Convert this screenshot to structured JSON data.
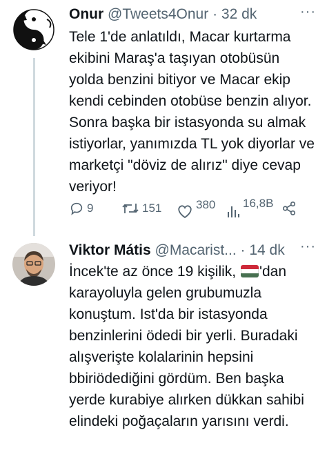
{
  "tweet1": {
    "name": "Onur",
    "handle": "@Tweets4Onur",
    "separator": "·",
    "time": "32 dk",
    "text": "Tele 1'de anlatıldı, Macar kurtarma ekibini Maraş'a taşıyan otobüsün yolda benzini bitiyor ve Macar ekip kendi cebinden otobüse benzin alıyor. Sonra başka bir istasyonda su almak istiyorlar, yanımızda TL yok diyorlar ve marketçi \"döviz de alırız\" diye cevap veriyor!",
    "actions": {
      "replies": "9",
      "retweets": "151",
      "likes": "380",
      "views": "16,8B"
    }
  },
  "tweet2": {
    "name": "Viktor Mátis",
    "handle": "@Macarist...",
    "separator": "·",
    "time": "14 dk",
    "text_before_flag": "İncek'te az önce 19 kişilik, ",
    "text_after_flag": "'dan karayoluyla gelen grubumuzla konuştum. Ist'da bir istasyonda benzinlerini ödedi bir yerli. Buradaki alışverişte kolalarinin hepsini bbiriödediğini gördüm. Ben başka yerde kurabiye alırken dükkan sahibi elindeki poğaçaların yarısını verdi.",
    "flag_colors": [
      "#ce2939",
      "#ffffff",
      "#477050"
    ]
  },
  "more_label": "···",
  "colors": {
    "text": "#0f1419",
    "muted": "#536471",
    "line": "#cfd9de"
  }
}
